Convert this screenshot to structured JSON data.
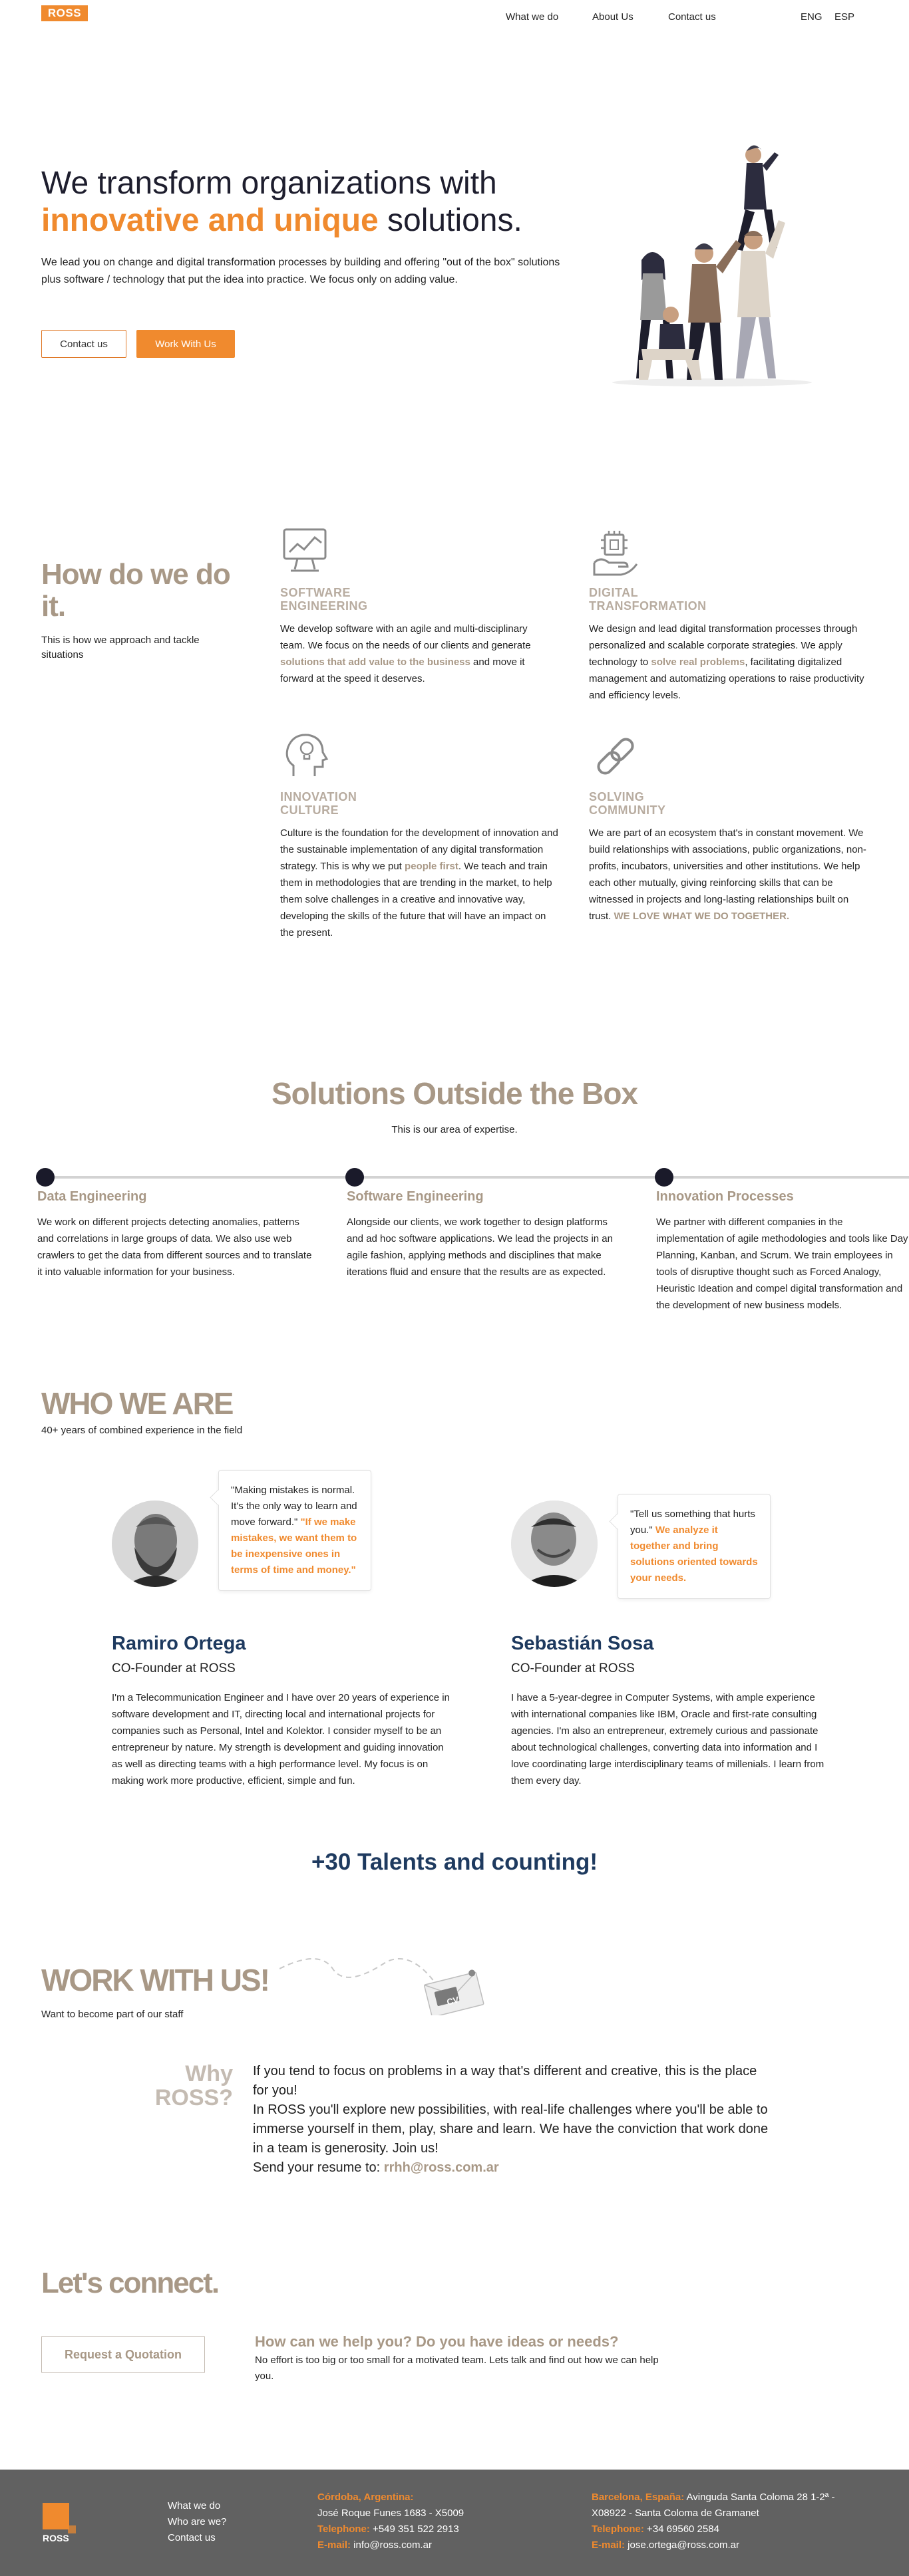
{
  "nav": {
    "logo": "ROSS",
    "links": [
      "What we do",
      "About Us",
      "Contact us"
    ],
    "lang": [
      "ENG",
      "ESP"
    ]
  },
  "hero": {
    "title_line1": "We transform organizations with",
    "title_accent": "innovative and unique",
    "title_end": " solutions.",
    "body": "We lead you on change and digital transformation processes by building and offering \"out of the box\" solutions plus software / technology that put the idea into practice. We focus only on adding value.",
    "btn_contact": "Contact us",
    "btn_work": "Work With Us"
  },
  "how": {
    "title": "How do we do it.",
    "subtitle": "This is how we approach and tackle situations",
    "features": [
      {
        "icon": "monitor-icon",
        "name_l1": "SOFTWARE",
        "name_l2": "ENGINEERING",
        "text_a": "We develop software with an agile and multi-disciplinary team. We focus on the needs of our clients and generate ",
        "hl": "solutions that add value to the business",
        "text_b": " and move it forward at the speed it deserves."
      },
      {
        "icon": "chip-hand-icon",
        "name_l1": "DIGITAL",
        "name_l2": "TRANSFORMATION",
        "text_a": "We design and lead digital transformation processes through personalized and scalable corporate strategies. We apply technology to ",
        "hl": "solve real problems",
        "text_b": ", facilitating digitalized management and automatizing operations to raise productivity and efficiency levels."
      },
      {
        "icon": "head-bulb-icon",
        "name_l1": "INNOVATION",
        "name_l2": "CULTURE",
        "text_a": "Culture is the foundation for the development of innovation and the sustainable implementation of any digital transformation strategy. This is why we put ",
        "hl": "people first",
        "text_b": ". We teach and train them in methodologies that are trending in the market, to help them solve challenges in a creative and innovative way, developing the skills of the future that will have an impact on the present."
      },
      {
        "icon": "chain-link-icon",
        "name_l1": "SOLVING",
        "name_l2": "COMMUNITY",
        "text_a": "We are part of an ecosystem that's in constant movement. We build relationships with associations, public organizations, non-profits, incubators, universities and other institutions. We help each other mutually, giving reinforcing skills that can be witnessed in projects and long-lasting relationships built on trust. ",
        "hl": "WE LOVE WHAT WE DO TOGETHER.",
        "text_b": ""
      }
    ]
  },
  "solutions": {
    "title": "Solutions Outside the Box",
    "subtitle": "This is our area of expertise.",
    "items": [
      {
        "name": "Data Engineering",
        "body": "We work on different projects detecting anomalies, patterns and correlations in large groups of data. We also use web crawlers to get the data from different sources and to translate it into valuable information for your business."
      },
      {
        "name": "Software Engineering",
        "body": "Alongside our clients, we work together to design platforms and ad hoc software applications. We lead the projects in an agile fashion, applying methods and disciplines that make iterations fluid and ensure that the results are as expected."
      },
      {
        "name": "Innovation Processes",
        "body": "We partner with different companies in the implementation of agile methodologies and tools like Day Planning, Kanban, and Scrum. We train employees in tools of disruptive thought such as Forced Analogy, Heuristic Ideation and compel digital transformation and the development of new business models."
      }
    ]
  },
  "who": {
    "title": "WHO WE ARE",
    "subtitle": "40+ years of combined experience in the field",
    "people": [
      {
        "quote_a": "\"Making mistakes is normal. It's the only way to learn and move forward.\" ",
        "quote_hl": "\"If we make mistakes, we want them to be inexpensive ones in terms of time and money.\"",
        "name": "Ramiro Ortega",
        "role": "CO-Founder at ROSS",
        "bio": "I'm a Telecommunication Engineer and I have over 20 years of experience in software development and IT, directing local and international projects for companies such as Personal, Intel and Kolektor. I consider myself to be an entrepreneur by nature. My strength is development and guiding innovation as well as directing teams with a high performance level. My focus is on making work more productive, efficient, simple and fun."
      },
      {
        "quote_a": "\"Tell us something that hurts you.\" ",
        "quote_hl": "We analyze it together and bring solutions oriented towards your needs.",
        "name": "Sebastián Sosa",
        "role": "CO-Founder at ROSS",
        "bio": "I have a 5-year-degree in Computer Systems, with ample experience with international companies like IBM, Oracle and first-rate consulting agencies. I'm also an entrepreneur, extremely curious and passionate about technological challenges, converting data into information and I love coordinating large interdisciplinary teams of millenials. I learn from them every day."
      }
    ],
    "talents": "+30 Talents and counting!"
  },
  "work": {
    "title": "WORK WITH US!",
    "subtitle": "Want to become part of our staff",
    "cv_label": "CV",
    "why_l1": "Why",
    "why_l2": "ROSS?",
    "why_p1": "If you tend to focus on problems in a way that's different and creative, this is the place for you!",
    "why_p2": "In ROSS you'll explore new possibilities, with real-life challenges where you'll be able to immerse yourself in them, play, share and learn. We have the conviction that work done in a team is generosity. Join us!",
    "why_p3": "Send your resume to: ",
    "email": "rrhh@ross.com.ar"
  },
  "connect": {
    "title": "Let's connect.",
    "btn": "Request a Quotation",
    "question": "How can we help you? Do you have ideas or needs?",
    "body": "No effort is too big or too small for a motivated team. Lets talk and find out how we can help you."
  },
  "footer": {
    "logo": "ROSS",
    "links": [
      "What we do",
      "Who are we?",
      "Contact us"
    ],
    "office1": {
      "city": "Córdoba, Argentina:",
      "addr": "José Roque Funes 1683 - X5009",
      "tel_label": "Telephone:",
      "tel": " +549 351 522 2913",
      "mail_label": "E-mail:",
      "mail": " info@ross.com.ar"
    },
    "office2": {
      "city": "Barcelona, España:",
      "addr_a": " Avinguda Santa Coloma 28 1-2ª -",
      "addr_b": "X08922 - Santa Coloma de Gramanet",
      "tel_label": "Telephone:",
      "tel": " +34 69560 2584",
      "mail_label": "E-mail:",
      "mail": " jose.ortega@ross.com.ar"
    }
  },
  "colors": {
    "accent": "#f08a2e",
    "taupe": "#a89886",
    "navy": "#1e3a5f",
    "footer": "#616161"
  }
}
